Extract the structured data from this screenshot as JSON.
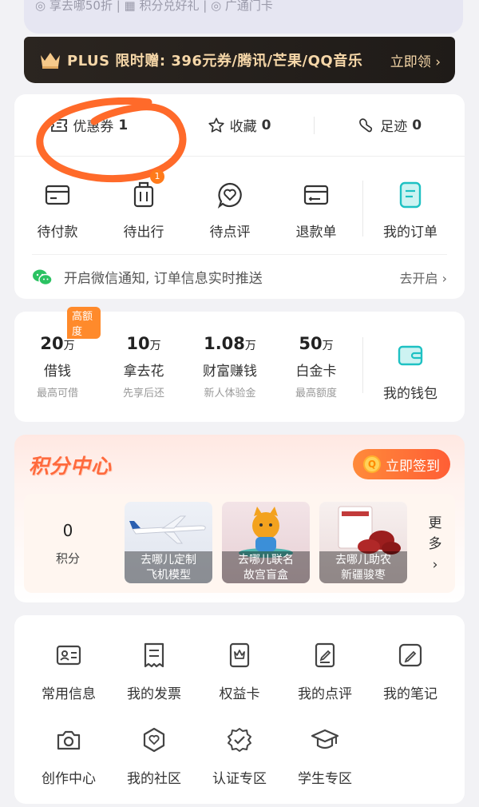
{
  "top_strip_text": "◎ 享去哪50折  |  ▦ 积分兑好礼  |  ◎ 广通门卡",
  "plus": {
    "text": "PLUS 限时赠: 396元券/腾讯/芒果/QQ音乐",
    "button": "立即领 ›"
  },
  "stats": [
    {
      "label": "优惠券",
      "count": "1",
      "icon": "coupon-icon"
    },
    {
      "label": "收藏",
      "count": "0",
      "icon": "star-icon"
    },
    {
      "label": "足迹",
      "count": "0",
      "icon": "footprint-icon"
    }
  ],
  "orders": [
    {
      "label": "待付款",
      "icon": "wallet-card-icon"
    },
    {
      "label": "待出行",
      "icon": "luggage-icon",
      "badge": "1"
    },
    {
      "label": "待点评",
      "icon": "review-heart-icon"
    },
    {
      "label": "退款单",
      "icon": "refund-icon"
    },
    {
      "label": "我的订单",
      "icon": "order-doc-icon"
    }
  ],
  "notify": {
    "text": "开启微信通知, 订单信息实时推送",
    "action": "去开启 ›",
    "icon": "wechat-icon"
  },
  "finance": [
    {
      "amount": "20",
      "unit": "万",
      "name": "借钱",
      "sub": "最高可借",
      "badge": "高额度"
    },
    {
      "amount": "10",
      "unit": "万",
      "name": "拿去花",
      "sub": "先享后还"
    },
    {
      "amount": "1.08",
      "unit": "万",
      "name": "财富赚钱",
      "sub": "新人体验金"
    },
    {
      "amount": "50",
      "unit": "万",
      "name": "白金卡",
      "sub": "最高额度"
    }
  ],
  "wallet": {
    "label": "我的钱包",
    "icon": "wallet-icon"
  },
  "points": {
    "title": "积分中心",
    "sign_button": "立即签到",
    "coin_glyph": "Q",
    "value": "0",
    "label": "积分",
    "products": [
      {
        "line1": "去哪儿定制",
        "line2": "飞机模型"
      },
      {
        "line1": "去哪儿联名",
        "line2": "故宫盲盒"
      },
      {
        "line1": "去哪儿助农",
        "line2": "新疆骏枣"
      }
    ],
    "more_chars": [
      "更",
      "多",
      "›"
    ]
  },
  "tools": [
    {
      "label": "常用信息",
      "icon": "id-card-icon"
    },
    {
      "label": "我的发票",
      "icon": "invoice-icon"
    },
    {
      "label": "权益卡",
      "icon": "benefit-card-icon"
    },
    {
      "label": "我的点评",
      "icon": "review-edit-icon"
    },
    {
      "label": "我的笔记",
      "icon": "note-pen-icon"
    },
    {
      "label": "创作中心",
      "icon": "camera-icon"
    },
    {
      "label": "我的社区",
      "icon": "community-icon"
    },
    {
      "label": "认证专区",
      "icon": "verify-badge-icon"
    },
    {
      "label": "学生专区",
      "icon": "graduation-cap-icon"
    }
  ],
  "colors": {
    "accent": "#ff6a3d",
    "badge": "#ff7a1a",
    "plus_gold": "#f6d7a8",
    "teal": "#1ec1c3",
    "annotation": "#ff6a2a"
  }
}
